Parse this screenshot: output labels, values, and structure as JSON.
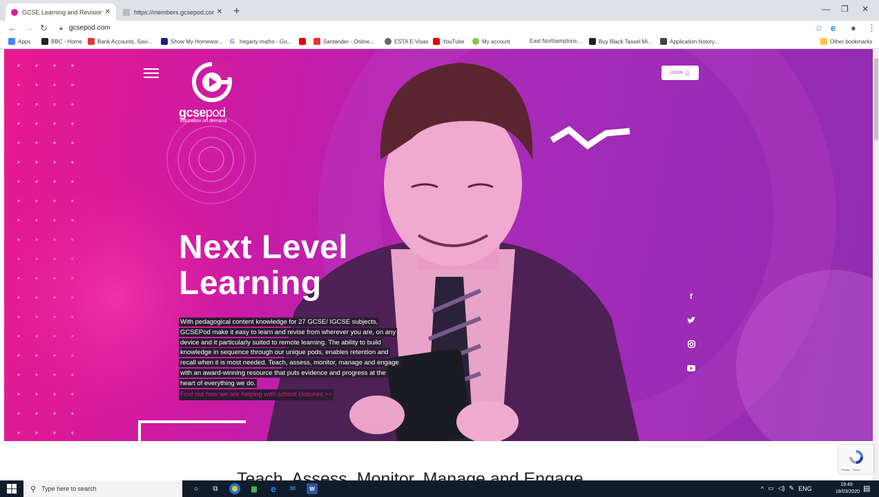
{
  "browser": {
    "tabs": [
      {
        "title": "GCSE Learning and Revision | GC",
        "active": true
      },
      {
        "title": "https://members.gcsepod.com/li",
        "active": false
      }
    ],
    "url": "gcsepod.com",
    "bookmarks": [
      "Apps",
      "BBC - Home",
      "Bank Accounts, Savi...",
      "Show My Homewor...",
      "hegarty maths - Go...",
      "Santander - Online...",
      "ESTA E-Visas",
      "YouTube",
      "My account",
      "East Northamptons...",
      "Buy Black Tassel Mi...",
      "Application history..."
    ],
    "other_bookmarks": "Other bookmarks"
  },
  "hero": {
    "logo_name_bold": "gcse",
    "logo_name_light": "pod",
    "logo_tagline": "education on demand",
    "login_label": "LOGIN",
    "title_line1": "Next Level",
    "title_line2": "Learning",
    "body": "With pedagogical content knowledge for 27 GCSE/ IGCSE subjects, GCSEPod make it easy to learn and revise from wherever you are, on any device and it particularly suited to remote learning. The ability to build knowledge in sequence through our unique pods, enables retention and recall when it is most needed. Teach, assess, monitor, manage and engage with an award-winning resource that puts evidence and progress at the heart of everything we do.",
    "link": "Find out how we are helping with school closures >>",
    "social": [
      "facebook-icon",
      "twitter-icon",
      "instagram-icon",
      "youtube-icon"
    ]
  },
  "section_title": "Teach, Assess, Monitor, Manage and Engage",
  "recaptcha_terms": "Privacy - Terms",
  "taskbar": {
    "search_placeholder": "Type here to search",
    "language": "ENG",
    "time": "19:49",
    "date": "18/03/2020"
  },
  "colors": {
    "brand_pink": "#e8198f",
    "brand_purple": "#9d2bb6",
    "text_box": "#2b1c30"
  }
}
